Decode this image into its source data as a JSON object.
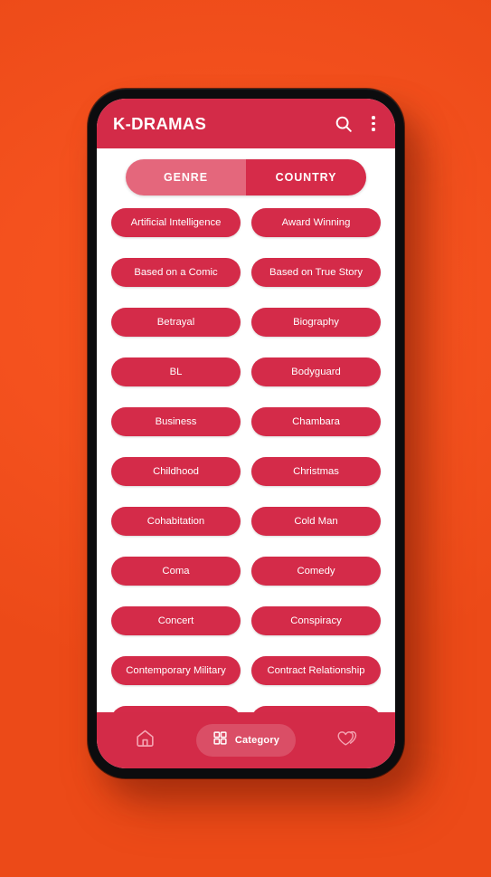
{
  "background": {
    "color": "#F4511E"
  },
  "device": {
    "frame_color": "#0C0C0E",
    "screen_color": "#FFFFFF"
  },
  "appbar": {
    "title": "K-DRAMAS",
    "background_color": "#D32B48",
    "search_icon": "search-icon",
    "overflow_icon": "more-vertical-icon"
  },
  "tabs": {
    "selected_index": 0,
    "selected_color": "#E4677C",
    "unselected_color": "#D62B49",
    "items": [
      {
        "label": "GENRE"
      },
      {
        "label": "COUNTRY"
      }
    ]
  },
  "chips": {
    "color": "#D42B49",
    "text_color": "#FFFFFF",
    "items": [
      {
        "label": "Artificial Intelligence"
      },
      {
        "label": "Award Winning"
      },
      {
        "label": "Based on a Comic"
      },
      {
        "label": "Based on True Story"
      },
      {
        "label": "Betrayal"
      },
      {
        "label": "Biography"
      },
      {
        "label": "BL"
      },
      {
        "label": "Bodyguard"
      },
      {
        "label": "Business"
      },
      {
        "label": "Chambara"
      },
      {
        "label": "Childhood"
      },
      {
        "label": "Christmas"
      },
      {
        "label": "Cohabitation"
      },
      {
        "label": "Cold Man"
      },
      {
        "label": "Coma"
      },
      {
        "label": "Comedy"
      },
      {
        "label": "Concert"
      },
      {
        "label": "Conspiracy"
      },
      {
        "label": "Contemporary Military"
      },
      {
        "label": "Contract Relationship"
      },
      {
        "label": ""
      },
      {
        "label": ""
      }
    ]
  },
  "bottom_nav": {
    "background_color": "#D32B48",
    "selected_index": 1,
    "items": [
      {
        "label": "",
        "icon": "home-icon"
      },
      {
        "label": "Category",
        "icon": "grid-icon"
      },
      {
        "label": "",
        "icon": "double-heart-icon"
      }
    ]
  }
}
